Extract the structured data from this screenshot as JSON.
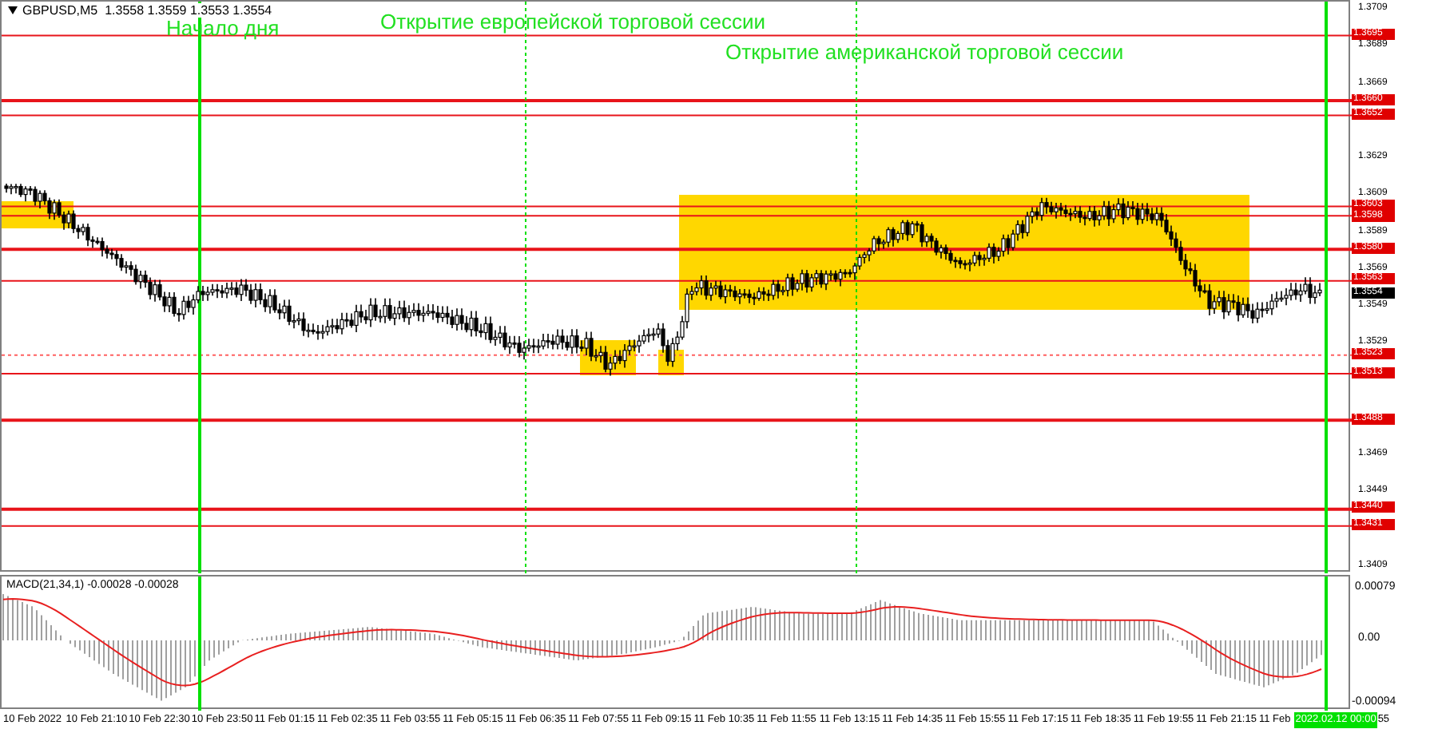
{
  "chart": {
    "symbol_header": "GBPUSD,M5  1.3558 1.3559 1.3553 1.3554",
    "annotations": [
      "Начало дня",
      "Открытие европейской торговой сессии",
      "Открытие американской торговой сессии"
    ],
    "price_axis": [
      "1.3709",
      "1.3689",
      "1.3669",
      "1.3629",
      "1.3609",
      "1.3589",
      "1.3569",
      "1.3549",
      "1.3529",
      "1.3469",
      "1.3449",
      "1.3409"
    ],
    "levels": [
      {
        "label": "1.3695",
        "kind": "minor"
      },
      {
        "label": "1.3660",
        "kind": "major"
      },
      {
        "label": "1.3652",
        "kind": "minor"
      },
      {
        "label": "1.3603",
        "kind": "minor"
      },
      {
        "label": "1.3598",
        "kind": "minor"
      },
      {
        "label": "1.3580",
        "kind": "major"
      },
      {
        "label": "1.3563",
        "kind": "minor"
      },
      {
        "label": "1.3523",
        "kind": "dotted"
      },
      {
        "label": "1.3513",
        "kind": "minor"
      },
      {
        "label": "1.3488",
        "kind": "major"
      },
      {
        "label": "1.3440",
        "kind": "major"
      },
      {
        "label": "1.3431",
        "kind": "minor"
      }
    ],
    "current_price": "1.3554"
  },
  "indicator": {
    "title": "MACD(21,34,1) -0.00028 -0.00028",
    "axis": [
      "0.00079",
      "0.00",
      "-0.00094"
    ]
  },
  "time_axis": [
    "10 Feb 2022",
    "10 Feb 21:10",
    "10 Feb 22:30",
    "10 Feb 23:50",
    "11 Feb 01:15",
    "11 Feb 02:35",
    "11 Feb 03:55",
    "11 Feb 05:15",
    "11 Feb 06:35",
    "11 Feb 07:55",
    "11 Feb 09:15",
    "11 Feb 10:35",
    "11 Feb 11:55",
    "11 Feb 13:15",
    "11 Feb 14:35",
    "11 Feb 15:55",
    "11 Feb 17:15",
    "11 Feb 18:35",
    "11 Feb 19:55",
    "11 Feb 21:15",
    "11 Feb"
  ],
  "cursor_time": "2022.02.12 00:00",
  "time_axis_tail": "55"
}
